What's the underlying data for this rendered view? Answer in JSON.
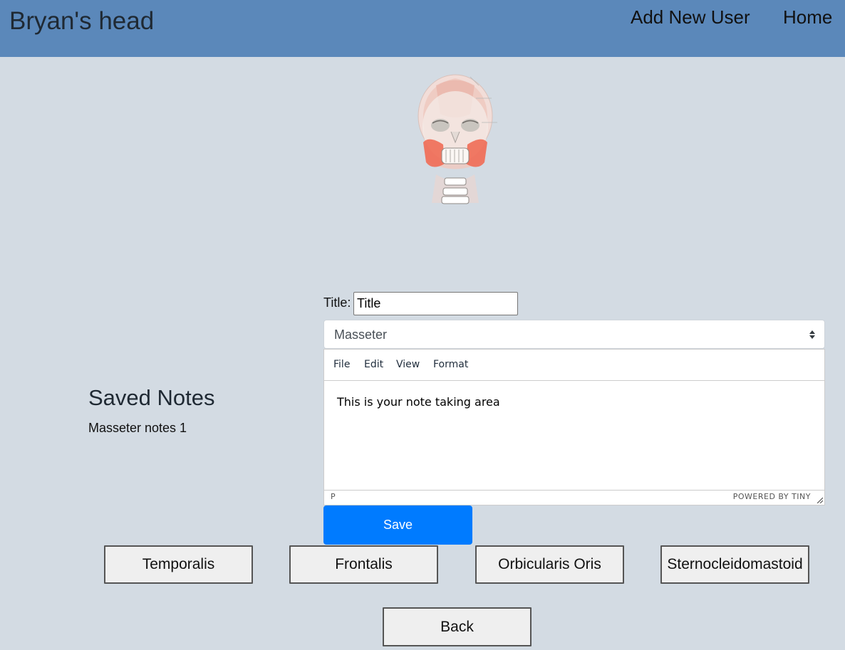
{
  "header": {
    "title": "Bryan's head",
    "nav": {
      "add_user": "Add New User",
      "home": "Home"
    }
  },
  "saved_notes": {
    "heading": "Saved Notes",
    "items": [
      "Masseter notes 1"
    ]
  },
  "form": {
    "title_label": "Title:",
    "title_value": "Title",
    "muscle_selected": "Masseter"
  },
  "editor": {
    "menu": [
      "File",
      "Edit",
      "View",
      "Format"
    ],
    "content": "This is your note taking area",
    "status_path": "P",
    "branding": "POWERED BY TINY"
  },
  "buttons": {
    "save": "Save",
    "muscles": [
      "Temporalis",
      "Frontalis",
      "Orbicularis Oris",
      "Sternocleidomastoid"
    ],
    "back": "Back"
  },
  "colors": {
    "header_bg": "#5b88ba",
    "page_bg": "#d3dbe3",
    "save_bg": "#007bff",
    "muscle_highlight": "#ef6b55"
  },
  "icons": {
    "head_figure": "skull-anatomy-illustration",
    "select_arrows": "updown-arrows-icon",
    "resize": "resize-handle-icon"
  }
}
